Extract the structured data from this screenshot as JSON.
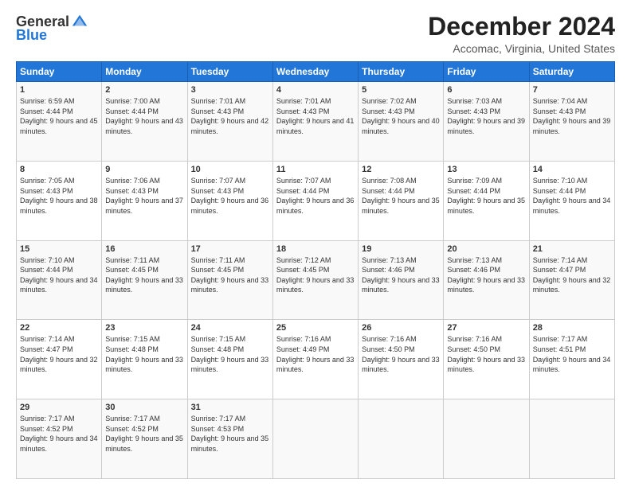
{
  "logo": {
    "general": "General",
    "blue": "Blue"
  },
  "title": "December 2024",
  "location": "Accomac, Virginia, United States",
  "days_header": [
    "Sunday",
    "Monday",
    "Tuesday",
    "Wednesday",
    "Thursday",
    "Friday",
    "Saturday"
  ],
  "weeks": [
    [
      {
        "day": "1",
        "rise": "6:59 AM",
        "set": "4:44 PM",
        "daylight": "9 hours and 45 minutes."
      },
      {
        "day": "2",
        "rise": "7:00 AM",
        "set": "4:44 PM",
        "daylight": "9 hours and 43 minutes."
      },
      {
        "day": "3",
        "rise": "7:01 AM",
        "set": "4:43 PM",
        "daylight": "9 hours and 42 minutes."
      },
      {
        "day": "4",
        "rise": "7:01 AM",
        "set": "4:43 PM",
        "daylight": "9 hours and 41 minutes."
      },
      {
        "day": "5",
        "rise": "7:02 AM",
        "set": "4:43 PM",
        "daylight": "9 hours and 40 minutes."
      },
      {
        "day": "6",
        "rise": "7:03 AM",
        "set": "4:43 PM",
        "daylight": "9 hours and 39 minutes."
      },
      {
        "day": "7",
        "rise": "7:04 AM",
        "set": "4:43 PM",
        "daylight": "9 hours and 39 minutes."
      }
    ],
    [
      {
        "day": "8",
        "rise": "7:05 AM",
        "set": "4:43 PM",
        "daylight": "9 hours and 38 minutes."
      },
      {
        "day": "9",
        "rise": "7:06 AM",
        "set": "4:43 PM",
        "daylight": "9 hours and 37 minutes."
      },
      {
        "day": "10",
        "rise": "7:07 AM",
        "set": "4:43 PM",
        "daylight": "9 hours and 36 minutes."
      },
      {
        "day": "11",
        "rise": "7:07 AM",
        "set": "4:44 PM",
        "daylight": "9 hours and 36 minutes."
      },
      {
        "day": "12",
        "rise": "7:08 AM",
        "set": "4:44 PM",
        "daylight": "9 hours and 35 minutes."
      },
      {
        "day": "13",
        "rise": "7:09 AM",
        "set": "4:44 PM",
        "daylight": "9 hours and 35 minutes."
      },
      {
        "day": "14",
        "rise": "7:10 AM",
        "set": "4:44 PM",
        "daylight": "9 hours and 34 minutes."
      }
    ],
    [
      {
        "day": "15",
        "rise": "7:10 AM",
        "set": "4:44 PM",
        "daylight": "9 hours and 34 minutes."
      },
      {
        "day": "16",
        "rise": "7:11 AM",
        "set": "4:45 PM",
        "daylight": "9 hours and 33 minutes."
      },
      {
        "day": "17",
        "rise": "7:11 AM",
        "set": "4:45 PM",
        "daylight": "9 hours and 33 minutes."
      },
      {
        "day": "18",
        "rise": "7:12 AM",
        "set": "4:45 PM",
        "daylight": "9 hours and 33 minutes."
      },
      {
        "day": "19",
        "rise": "7:13 AM",
        "set": "4:46 PM",
        "daylight": "9 hours and 33 minutes."
      },
      {
        "day": "20",
        "rise": "7:13 AM",
        "set": "4:46 PM",
        "daylight": "9 hours and 33 minutes."
      },
      {
        "day": "21",
        "rise": "7:14 AM",
        "set": "4:47 PM",
        "daylight": "9 hours and 32 minutes."
      }
    ],
    [
      {
        "day": "22",
        "rise": "7:14 AM",
        "set": "4:47 PM",
        "daylight": "9 hours and 32 minutes."
      },
      {
        "day": "23",
        "rise": "7:15 AM",
        "set": "4:48 PM",
        "daylight": "9 hours and 33 minutes."
      },
      {
        "day": "24",
        "rise": "7:15 AM",
        "set": "4:48 PM",
        "daylight": "9 hours and 33 minutes."
      },
      {
        "day": "25",
        "rise": "7:16 AM",
        "set": "4:49 PM",
        "daylight": "9 hours and 33 minutes."
      },
      {
        "day": "26",
        "rise": "7:16 AM",
        "set": "4:50 PM",
        "daylight": "9 hours and 33 minutes."
      },
      {
        "day": "27",
        "rise": "7:16 AM",
        "set": "4:50 PM",
        "daylight": "9 hours and 33 minutes."
      },
      {
        "day": "28",
        "rise": "7:17 AM",
        "set": "4:51 PM",
        "daylight": "9 hours and 34 minutes."
      }
    ],
    [
      {
        "day": "29",
        "rise": "7:17 AM",
        "set": "4:52 PM",
        "daylight": "9 hours and 34 minutes."
      },
      {
        "day": "30",
        "rise": "7:17 AM",
        "set": "4:52 PM",
        "daylight": "9 hours and 35 minutes."
      },
      {
        "day": "31",
        "rise": "7:17 AM",
        "set": "4:53 PM",
        "daylight": "9 hours and 35 minutes."
      },
      null,
      null,
      null,
      null
    ]
  ]
}
